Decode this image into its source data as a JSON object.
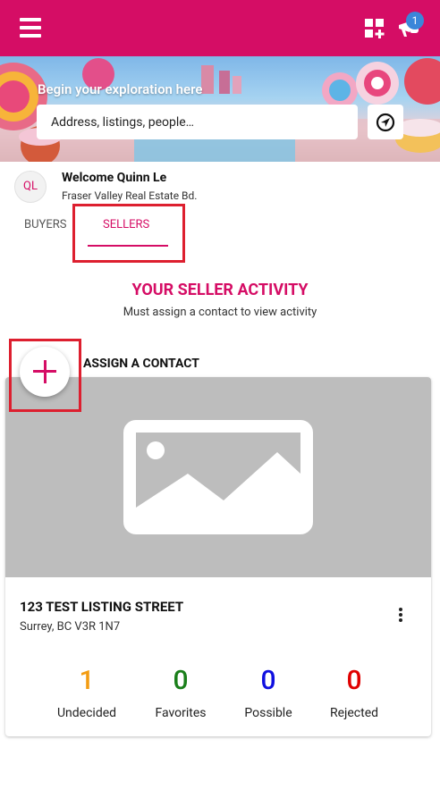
{
  "colors": {
    "brand": "#d50d65",
    "highlight_box": "#dd1f2f",
    "badge": "#3b86d9"
  },
  "header": {
    "menu_icon": "hamburger-menu-icon",
    "grid_icon": "grid-add-icon",
    "notification_icon": "megaphone-icon",
    "notification_count": "1"
  },
  "hero": {
    "title": "Begin your exploration here",
    "search_placeholder": "Address, listings, people…",
    "locate_icon": "location-arrow-icon"
  },
  "user": {
    "initials": "QL",
    "welcome": "Welcome Quinn Le",
    "board": "Fraser Valley Real Estate Bd."
  },
  "tabs": {
    "buyers": "BUYERS",
    "sellers": "SELLERS",
    "active": "SELLERS"
  },
  "activity": {
    "title": "YOUR SELLER ACTIVITY",
    "subtitle": "Must assign a contact to view activity"
  },
  "assign": {
    "label": "ASSIGN A CONTACT",
    "icon": "plus-icon"
  },
  "listing": {
    "image_icon": "image-placeholder-icon",
    "address": "123 TEST LISTING STREET",
    "city": "Surrey, BC V3R 1N7",
    "stats": [
      {
        "value": "1",
        "label": "Undecided",
        "color": "#f39c12"
      },
      {
        "value": "0",
        "label": "Favorites",
        "color": "#1a7f1a"
      },
      {
        "value": "0",
        "label": "Possible",
        "color": "#1010e0"
      },
      {
        "value": "0",
        "label": "Rejected",
        "color": "#e00000"
      }
    ]
  }
}
